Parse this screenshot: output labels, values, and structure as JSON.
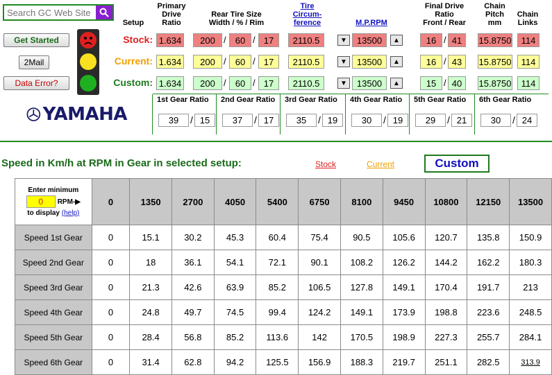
{
  "search": {
    "placeholder": "Search GC Web Site"
  },
  "side_buttons": {
    "get_started": "Get Started",
    "mail": "2Mail",
    "data_error": "Data Error?"
  },
  "headers": {
    "setup": "Setup",
    "primary_drive": "Primary Drive Ratio",
    "rear_tire": "Rear Tire Size",
    "rear_tire_sub": "Width / % / Rim",
    "tire_circ": "Tire Circum- ference",
    "mprpm": "M.P.RPM",
    "final_drive": "Final Drive Ratio",
    "final_drive_sub": "Front / Rear",
    "chain_pitch": "Chain Pitch mm",
    "chain_links": "Chain Links"
  },
  "rows": [
    {
      "label": "Stock:",
      "color": "#e02020",
      "bg": "#ef8080",
      "primary": "1.634",
      "width": "200",
      "pct": "60",
      "rim": "17",
      "circ": "2110.5",
      "rpm": "13500",
      "front": "16",
      "rear": "41",
      "pitch": "15.8750",
      "links": "114"
    },
    {
      "label": "Current:",
      "color": "#f0a000",
      "bg": "#ffff99",
      "primary": "1.634",
      "width": "200",
      "pct": "60",
      "rim": "17",
      "circ": "2110.5",
      "rpm": "13500",
      "front": "16",
      "rear": "43",
      "pitch": "15.8750",
      "links": "114"
    },
    {
      "label": "Custom:",
      "color": "#1f7a1f",
      "bg": "#ccffcc",
      "primary": "1.634",
      "width": "200",
      "pct": "60",
      "rim": "17",
      "circ": "2110.5",
      "rpm": "13500",
      "front": "15",
      "rear": "40",
      "pitch": "15.8750",
      "links": "114"
    }
  ],
  "logo": "YAMAHA",
  "gears": [
    {
      "label": "1st Gear Ratio",
      "a": "39",
      "b": "15"
    },
    {
      "label": "2nd Gear Ratio",
      "a": "37",
      "b": "17"
    },
    {
      "label": "3rd Gear Ratio",
      "a": "35",
      "b": "19"
    },
    {
      "label": "4th Gear Ratio",
      "a": "30",
      "b": "19"
    },
    {
      "label": "5th Gear Ratio",
      "a": "29",
      "b": "21"
    },
    {
      "label": "6th Gear Ratio",
      "a": "30",
      "b": "24"
    }
  ],
  "speed_title": "Speed in Km/h at RPM in Gear in selected setup:",
  "setup_links": {
    "stock": "Stock",
    "current": "Current",
    "custom": "Custom"
  },
  "table": {
    "corner_line1": "Enter minimum",
    "min_rpm": "0",
    "rpm_label": "RPM-▶",
    "to_display": "to display",
    "help": "(help)",
    "rpm_headers": [
      "0",
      "1350",
      "2700",
      "4050",
      "5400",
      "6750",
      "8100",
      "9450",
      "10800",
      "12150",
      "13500"
    ],
    "rows": [
      {
        "label": "Speed 1st Gear",
        "values": [
          "0",
          "15.1",
          "30.2",
          "45.3",
          "60.4",
          "75.4",
          "90.5",
          "105.6",
          "120.7",
          "135.8",
          "150.9"
        ]
      },
      {
        "label": "Speed 2nd Gear",
        "values": [
          "0",
          "18",
          "36.1",
          "54.1",
          "72.1",
          "90.1",
          "108.2",
          "126.2",
          "144.2",
          "162.2",
          "180.3"
        ]
      },
      {
        "label": "Speed 3rd Gear",
        "values": [
          "0",
          "21.3",
          "42.6",
          "63.9",
          "85.2",
          "106.5",
          "127.8",
          "149.1",
          "170.4",
          "191.7",
          "213"
        ]
      },
      {
        "label": "Speed 4th Gear",
        "values": [
          "0",
          "24.8",
          "49.7",
          "74.5",
          "99.4",
          "124.2",
          "149.1",
          "173.9",
          "198.8",
          "223.6",
          "248.5"
        ]
      },
      {
        "label": "Speed 5th Gear",
        "values": [
          "0",
          "28.4",
          "56.8",
          "85.2",
          "113.6",
          "142",
          "170.5",
          "198.9",
          "227.3",
          "255.7",
          "284.1"
        ]
      },
      {
        "label": "Speed 6th Gear",
        "values": [
          "0",
          "31.4",
          "62.8",
          "94.2",
          "125.5",
          "156.9",
          "188.3",
          "219.7",
          "251.1",
          "282.5",
          "313.9"
        ]
      }
    ]
  }
}
